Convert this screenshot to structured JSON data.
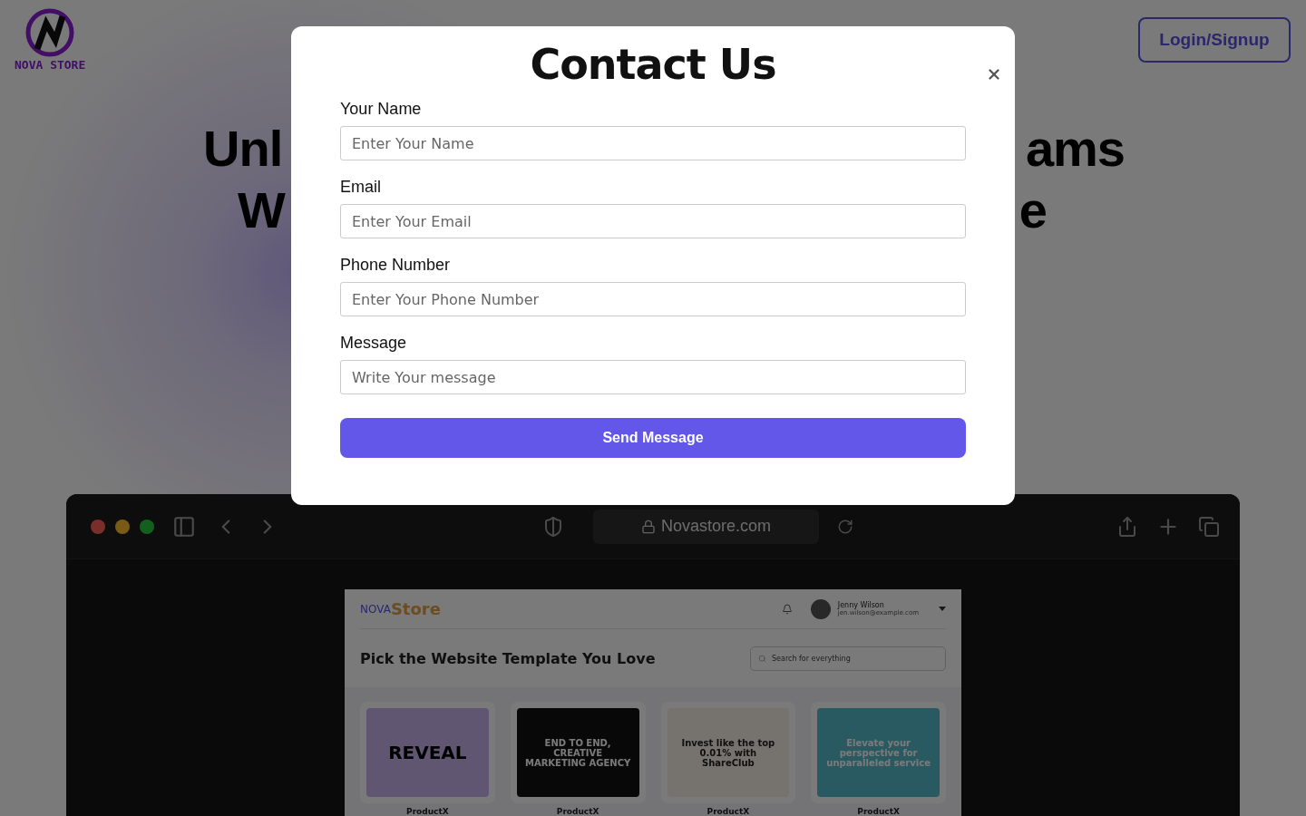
{
  "header": {
    "logo_text": "NOVA STORE",
    "login_button": "Login/Signup"
  },
  "hero": {
    "lines": [
      {
        "left": "Unl",
        "right": "ams"
      },
      {
        "left": "W",
        "right": "e"
      }
    ]
  },
  "browser": {
    "url": "Novastore.com",
    "page": {
      "logo_prefix": "NOVA",
      "logo_suffix": "Store",
      "user_name": "Jenny Wilson",
      "user_email": "jen.wilson@example.com",
      "heading": "Pick the Website Template You Love",
      "search_placeholder": "Search for everything",
      "templates": [
        {
          "kind": "lilac",
          "headline": "REVEAL",
          "label": "ProductX"
        },
        {
          "kind": "dark",
          "headline": "END TO END, CREATIVE MARKETING AGENCY",
          "label": "ProductX"
        },
        {
          "kind": "cream",
          "headline": "Invest like the top 0.01% with ShareClub",
          "label": "ProductX"
        },
        {
          "kind": "sky",
          "headline": "Elevate your perspective for unparalleled service",
          "label": "ProductX"
        }
      ]
    }
  },
  "modal": {
    "title": "Contact Us",
    "fields": [
      {
        "label": "Your Name",
        "placeholder": "Enter Your Name"
      },
      {
        "label": "Email",
        "placeholder": "Enter Your Email"
      },
      {
        "label": "Phone Number",
        "placeholder": "Enter Your Phone Number"
      },
      {
        "label": "Message",
        "placeholder": "Write Your message"
      }
    ],
    "submit": "Send Message"
  }
}
